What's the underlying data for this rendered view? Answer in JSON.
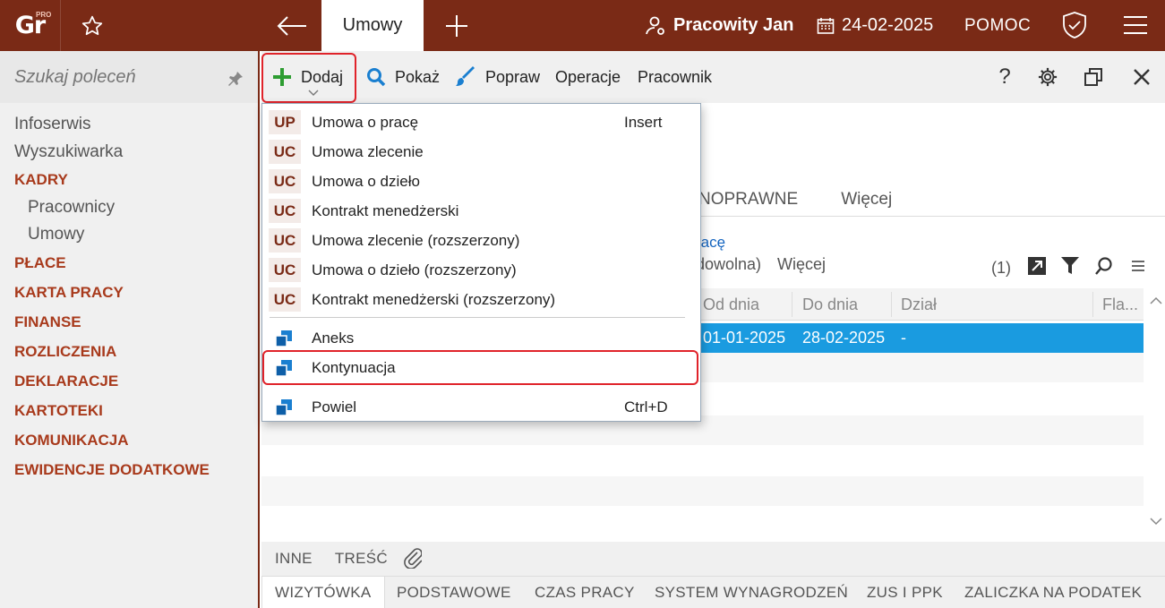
{
  "app": {
    "logo_text": "Gr",
    "logo_badge": "PRO",
    "active_tab": "Umowy",
    "user_name": "Pracowity Jan",
    "date": "24-02-2025",
    "help_label": "POMOC"
  },
  "sidebar": {
    "search_placeholder": "Szukaj poleceń",
    "items": [
      {
        "label": "Infoserwis"
      },
      {
        "label": "Wyszukiwarka"
      },
      {
        "label": "KADRY"
      },
      {
        "label": "Pracownicy"
      },
      {
        "label": "Umowy"
      },
      {
        "label": "PŁACE"
      },
      {
        "label": "KARTA PRACY"
      },
      {
        "label": "FINANSE"
      },
      {
        "label": "ROZLICZENIA"
      },
      {
        "label": "DEKLARACJE"
      },
      {
        "label": "KARTOTEKI"
      },
      {
        "label": "KOMUNIKACJA"
      },
      {
        "label": "EWIDENCJE DODATKOWE"
      }
    ]
  },
  "toolbar": {
    "add_label": "Dodaj",
    "show_label": "Pokaż",
    "edit_label": "Popraw",
    "operations_label": "Operacje",
    "employee_label": "Pracownik",
    "help_symbol": "?"
  },
  "dropdown": {
    "items": [
      {
        "badge": "UP",
        "label": "Umowa o pracę",
        "shortcut": "Insert"
      },
      {
        "badge": "UC",
        "label": "Umowa zlecenie",
        "shortcut": ""
      },
      {
        "badge": "UC",
        "label": "Umowa o dzieło",
        "shortcut": ""
      },
      {
        "badge": "UC",
        "label": "Kontrakt menedżerski",
        "shortcut": ""
      },
      {
        "badge": "UC",
        "label": "Umowa zlecenie (rozszerzony)",
        "shortcut": ""
      },
      {
        "badge": "UC",
        "label": "Umowa o dzieło (rozszerzony)",
        "shortcut": ""
      },
      {
        "badge": "UC",
        "label": "Kontrakt menedżerski (rozszerzony)",
        "shortcut": ""
      },
      {
        "label": "Aneks",
        "shortcut": ""
      },
      {
        "label": "Kontynuacja",
        "shortcut": ""
      },
      {
        "label": "Powiel",
        "shortcut": "Ctrl+D"
      }
    ]
  },
  "content": {
    "tab_partial": "NOPRAWNE",
    "tab_more": "Więcej",
    "link_partial": "racę",
    "filter_partial": "dowolna)",
    "filter_more": "Więcej",
    "count": "(1)",
    "columns": [
      "Od dnia",
      "Do dnia",
      "Dział",
      "Fla..."
    ],
    "rows": [
      {
        "from": "01-01-2025",
        "to": "28-02-2025",
        "dept": "-"
      }
    ]
  },
  "bottom": {
    "tabs_row1": [
      "INNE",
      "TREŚĆ"
    ],
    "tabs_row2": [
      "WIZYTÓWKA",
      "PODSTAWOWE",
      "CZAS PRACY",
      "SYSTEM WYNAGRODZEŃ",
      "ZUS I PPK",
      "ZALICZKA NA PODATEK"
    ]
  },
  "colors": {
    "brand": "#7a2a16",
    "selection": "#1a9be0",
    "highlight_border": "#e0232a"
  }
}
